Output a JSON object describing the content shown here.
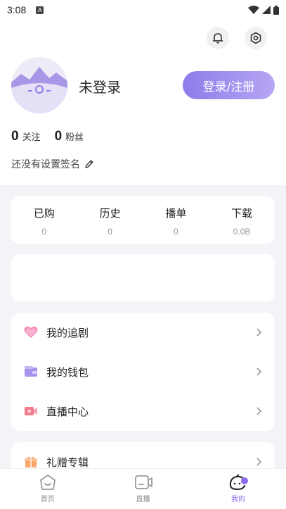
{
  "status_bar": {
    "time": "3:08",
    "sim_label": "A"
  },
  "profile": {
    "username": "未登录",
    "login_button": "登录/注册",
    "following_count": "0",
    "following_label": "关注",
    "fans_count": "0",
    "fans_label": "粉丝",
    "signature": "还没有设置签名"
  },
  "stats": [
    {
      "label": "已购",
      "value": "0"
    },
    {
      "label": "历史",
      "value": "0"
    },
    {
      "label": "播单",
      "value": "0"
    },
    {
      "label": "下载",
      "value": "0.0B"
    }
  ],
  "menu": [
    {
      "label": "我的追剧",
      "icon": "heart-icon"
    },
    {
      "label": "我的钱包",
      "icon": "wallet-icon"
    },
    {
      "label": "直播中心",
      "icon": "live-camera-icon"
    },
    {
      "label": "礼赠专辑",
      "icon": "gift-icon"
    }
  ],
  "tabs": [
    {
      "label": "首页",
      "icon": "home-icon"
    },
    {
      "label": "直播",
      "icon": "live-icon"
    },
    {
      "label": "我的",
      "icon": "profile-icon",
      "active": true
    }
  ],
  "colors": {
    "accent": "#8b6cf0",
    "login_gradient_start": "#8e7ce9",
    "login_gradient_end": "#b6a6f4"
  }
}
